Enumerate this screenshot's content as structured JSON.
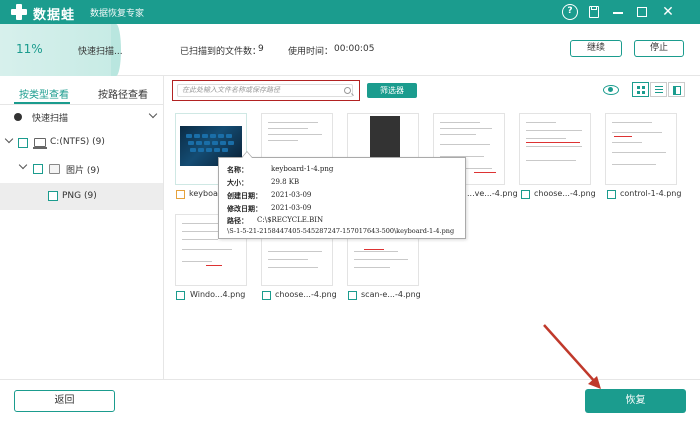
{
  "app": {
    "brand": "数据蛙",
    "subtitle": "数据恢复专家",
    "help_glyph": "?",
    "close_glyph": "✕"
  },
  "scan": {
    "percent_text": "11%",
    "percent_value": 11,
    "status": "快速扫描...",
    "files_label": "已扫描到的文件数：",
    "files_value": "9",
    "time_label": "使用时间：",
    "time_value": "00:00:05",
    "continue_label": "继续",
    "stop_label": "停止"
  },
  "left": {
    "tabs": [
      {
        "label": "按类型查看",
        "active": true
      },
      {
        "label": "按路径查看",
        "active": false
      }
    ],
    "tree": {
      "root": "快速扫描",
      "drive": "C:(NTFS) (9)",
      "folder": "图片 (9)",
      "type": "PNG (9)"
    }
  },
  "toolbar": {
    "search_placeholder": "在此处输入文件名称或保存路径",
    "filter_label": "筛选器"
  },
  "files": [
    {
      "name": "keyboa...4.png",
      "kind": "keyboard",
      "checked_style": "orange"
    },
    {
      "name": "",
      "kind": "doc"
    },
    {
      "name": "",
      "kind": "dark"
    },
    {
      "name": "...ve...-4.png",
      "kind": "doc"
    },
    {
      "name": "choose...-4.png",
      "kind": "doc"
    },
    {
      "name": "control-1-4.png",
      "kind": "doc"
    },
    {
      "name": "Windo...4.png",
      "kind": "doc"
    },
    {
      "name": "choose...-4.png",
      "kind": "doc"
    },
    {
      "name": "scan-e...-4.png",
      "kind": "doc"
    }
  ],
  "tooltip": {
    "name_key": "名称：",
    "name_val": "keyboard-1-4.png",
    "size_key": "大小：",
    "size_val": "29.8 KB",
    "created_key": "创建日期：",
    "created_val": "2021-03-09",
    "modified_key": "修改日期：",
    "modified_val": "2021-03-09",
    "path_key": "路径：",
    "path_val": "C:\\$RECYCLE.BIN",
    "path_val2": "\\S-1-5-21-2158447405-545287247-157017643-500\\keyboard-1-4.png"
  },
  "bottom": {
    "back_label": "返回",
    "recover_label": "恢复"
  },
  "colors": {
    "accent": "#1b9c8e",
    "highlight_box": "#b22222",
    "annotation_arrow": "#c0392b"
  }
}
